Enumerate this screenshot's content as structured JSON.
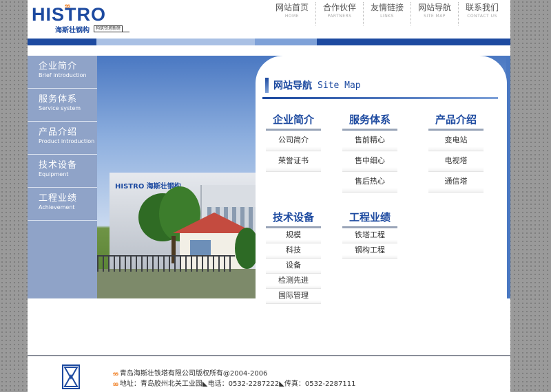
{
  "logo": {
    "wordmark": "HISTRO",
    "mark": "ᵴᵴ",
    "cn_name": "海斯壮钢构",
    "slogan": "构筑铁塔新磅"
  },
  "nav": [
    {
      "cn": "网站首页",
      "en": "HOME"
    },
    {
      "cn": "合作伙伴",
      "en": "PARTNERS"
    },
    {
      "cn": "友情链接",
      "en": "LINKS"
    },
    {
      "cn": "网站导航",
      "en": "SITE MAP"
    },
    {
      "cn": "联系我们",
      "en": "CONTACT US"
    }
  ],
  "sidebar": [
    {
      "cn": "企业简介",
      "en": "Brief introduction"
    },
    {
      "cn": "服务体系",
      "en": "Service system"
    },
    {
      "cn": "产品介绍",
      "en": "Product introduction"
    },
    {
      "cn": "技术设备",
      "en": "Equipment"
    },
    {
      "cn": "工程业绩",
      "en": "Achievement"
    }
  ],
  "photo_sign": "HISTRO 海斯壮钢构",
  "sitemap": {
    "title_cn": "网站导航",
    "title_en": "Site Map",
    "columns": [
      {
        "head": "企业简介",
        "links": [
          "公司简介",
          "荣誉证书"
        ]
      },
      {
        "head": "服务体系",
        "links": [
          "售前精心",
          "售中细心",
          "售后热心"
        ]
      },
      {
        "head": "产品介绍",
        "links": [
          "变电站",
          "电视塔",
          "通信塔"
        ]
      },
      {
        "head": "技术设备",
        "links": [
          "规模",
          "科技",
          "设备",
          "检测先进",
          "国际管理"
        ]
      },
      {
        "head": "工程业绩",
        "links": [
          "铁塔工程",
          "钢构工程"
        ]
      }
    ]
  },
  "footer": {
    "mark": "ᵴᵴ",
    "copyright": "青岛海斯壮铁塔有限公司版权所有@2004-2006",
    "address": "地址：青岛胶州北关工业园◣电话：0532-2287222◣传真：0532-2287111"
  },
  "colors": {
    "brand": "#1d4aa0",
    "accent": "#f07a1a",
    "menu_bg": "#8fa3c8"
  }
}
